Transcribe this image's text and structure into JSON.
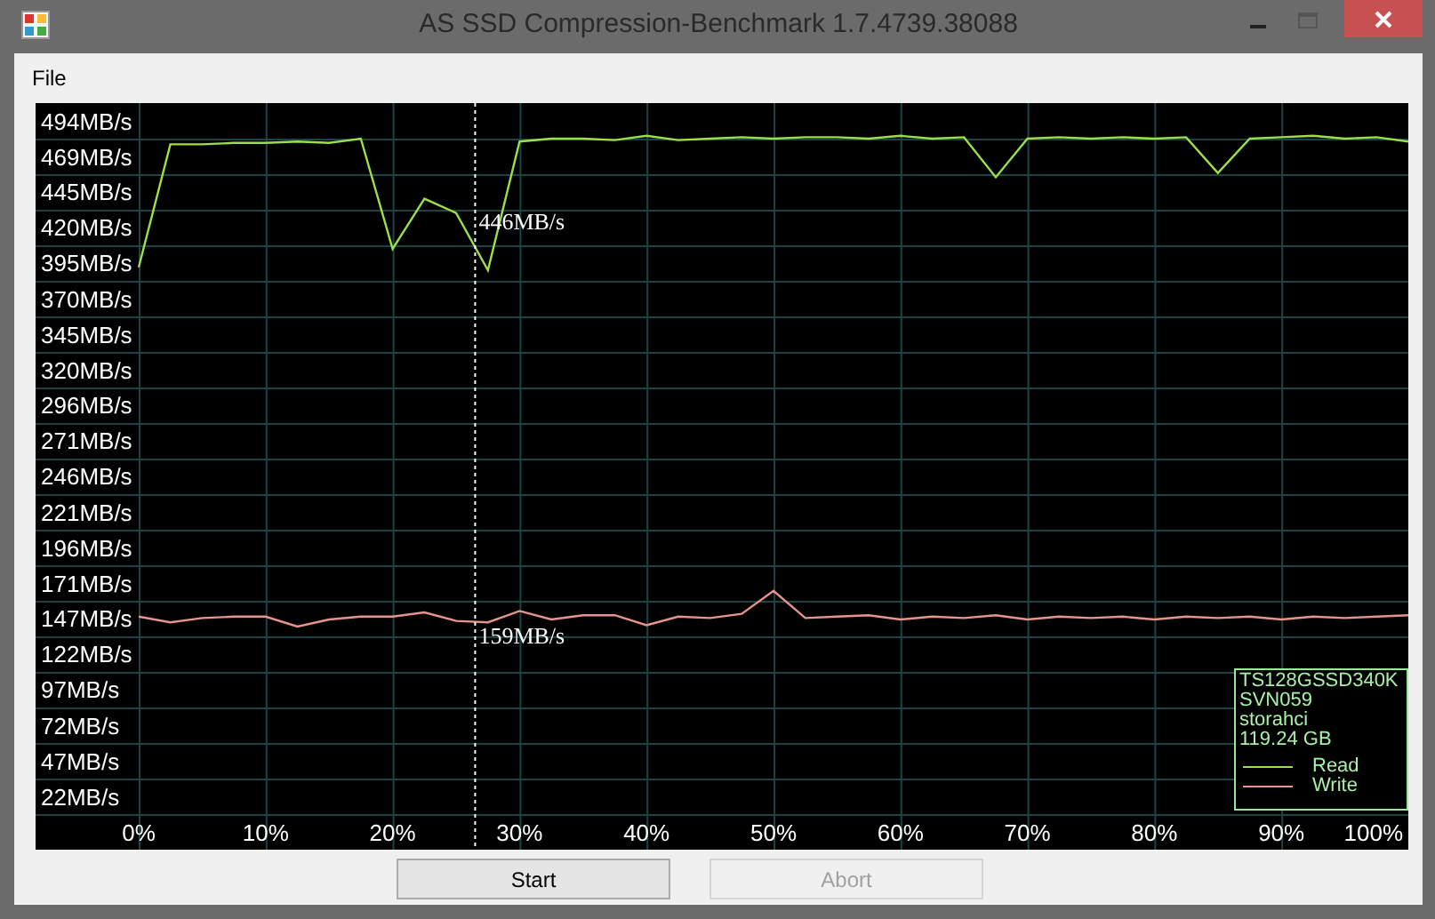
{
  "window": {
    "title": "AS SSD Compression-Benchmark 1.7.4739.38088"
  },
  "menu": [
    {
      "label": "File"
    }
  ],
  "chart": {
    "chart_data": {
      "type": "line",
      "x": [
        0,
        2.5,
        5,
        7.5,
        10,
        12.5,
        15,
        17.5,
        20,
        22.5,
        25,
        27.5,
        30,
        32.5,
        35,
        37.5,
        40,
        42.5,
        45,
        47.5,
        50,
        52.5,
        55,
        57.5,
        60,
        62.5,
        65,
        67.5,
        70,
        72.5,
        75,
        77.5,
        80,
        82.5,
        85,
        87.5,
        90,
        92.5,
        95,
        97.5,
        100
      ],
      "series": [
        {
          "name": "Read",
          "color": "#9be04a",
          "values": [
            404,
            490,
            490,
            491,
            491,
            492,
            491,
            494,
            417,
            452,
            442,
            402,
            492,
            494,
            494,
            493,
            496,
            493,
            494,
            495,
            494,
            495,
            495,
            494,
            496,
            494,
            495,
            467,
            494,
            495,
            494,
            495,
            494,
            495,
            470,
            494,
            495,
            496,
            494,
            495,
            492
          ]
        },
        {
          "name": "Write",
          "color": "#e8948c",
          "values": [
            160,
            156,
            159,
            160,
            160,
            153,
            158,
            160,
            160,
            163,
            157,
            156,
            164,
            158,
            161,
            161,
            154,
            160,
            159,
            162,
            178,
            159,
            160,
            161,
            158,
            160,
            159,
            161,
            158,
            160,
            159,
            160,
            158,
            160,
            159,
            160,
            158,
            160,
            159,
            160,
            161
          ]
        }
      ],
      "xlim": [
        0,
        100
      ],
      "ylim": [
        -2.8,
        518.8
      ],
      "grid": true,
      "xticks": [
        {
          "value": 0,
          "label": "0%"
        },
        {
          "value": 10,
          "label": "10%"
        },
        {
          "value": 20,
          "label": "20%"
        },
        {
          "value": 30,
          "label": "30%"
        },
        {
          "value": 40,
          "label": "40%"
        },
        {
          "value": 50,
          "label": "50%"
        },
        {
          "value": 60,
          "label": "60%"
        },
        {
          "value": 70,
          "label": "70%"
        },
        {
          "value": 80,
          "label": "80%"
        },
        {
          "value": 90,
          "label": "90%"
        },
        {
          "value": 100,
          "label": "100%"
        }
      ],
      "yticks": [
        {
          "value": 494,
          "label": "494MB/s"
        },
        {
          "value": 469,
          "label": "469MB/s"
        },
        {
          "value": 445,
          "label": "445MB/s"
        },
        {
          "value": 420,
          "label": "420MB/s"
        },
        {
          "value": 395,
          "label": "395MB/s"
        },
        {
          "value": 370,
          "label": "370MB/s"
        },
        {
          "value": 345,
          "label": "345MB/s"
        },
        {
          "value": 320,
          "label": "320MB/s"
        },
        {
          "value": 296,
          "label": "296MB/s"
        },
        {
          "value": 271,
          "label": "271MB/s"
        },
        {
          "value": 246,
          "label": "246MB/s"
        },
        {
          "value": 221,
          "label": "221MB/s"
        },
        {
          "value": 196,
          "label": "196MB/s"
        },
        {
          "value": 171,
          "label": "171MB/s"
        },
        {
          "value": 147,
          "label": "147MB/s"
        },
        {
          "value": 122,
          "label": "122MB/s"
        },
        {
          "value": 97,
          "label": "97MB/s"
        },
        {
          "value": 72,
          "label": "72MB/s"
        },
        {
          "value": 47,
          "label": "47MB/s"
        },
        {
          "value": 22,
          "label": "22MB/s"
        }
      ],
      "ref_lines": [
        {
          "axis": "x",
          "value": 26.5
        }
      ],
      "annotations": [
        "446MB/s",
        "159MB/s"
      ]
    }
  },
  "drive_info": {
    "model": "TS128GSSD340K",
    "firmware": "SVN059",
    "driver": "storahci",
    "size": "119.24 GB"
  },
  "buttons": [
    {
      "label": "Start",
      "disabled": false
    },
    {
      "label": "Abort",
      "disabled": true
    }
  ]
}
